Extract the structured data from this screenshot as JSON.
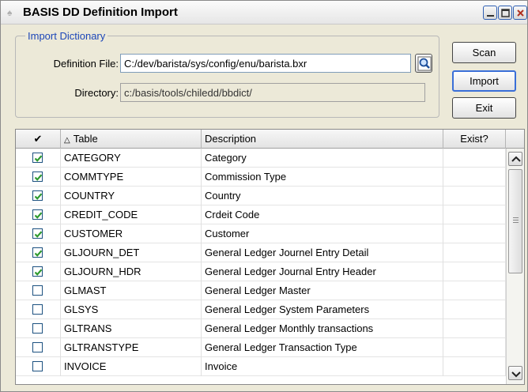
{
  "window": {
    "title": "BASIS DD Definition Import"
  },
  "group": {
    "legend": "Import Dictionary",
    "definition_label": "Definition File:",
    "definition_value": "C:/dev/barista/sys/config/enu/barista.bxr",
    "directory_label": "Directory:",
    "directory_value": "c:/basis/tools/chiledd/bbdict/"
  },
  "actions": {
    "scan": "Scan",
    "import": "Import",
    "exit": "Exit"
  },
  "grid": {
    "headers": {
      "check": "✔",
      "table": "Table",
      "description": "Description",
      "exist": "Exist?"
    },
    "rows": [
      {
        "checked": true,
        "table": "CATEGORY",
        "description": "Category",
        "exist": ""
      },
      {
        "checked": true,
        "table": "COMMTYPE",
        "description": "Commission Type",
        "exist": ""
      },
      {
        "checked": true,
        "table": "COUNTRY",
        "description": "Country",
        "exist": ""
      },
      {
        "checked": true,
        "table": "CREDIT_CODE",
        "description": "Crdeit Code",
        "exist": ""
      },
      {
        "checked": true,
        "table": "CUSTOMER",
        "description": "Customer",
        "exist": ""
      },
      {
        "checked": true,
        "table": "GLJOURN_DET",
        "description": "General Ledger Journel Entry Detail",
        "exist": ""
      },
      {
        "checked": true,
        "table": "GLJOURN_HDR",
        "description": "General Ledger Journal Entry Header",
        "exist": ""
      },
      {
        "checked": false,
        "table": "GLMAST",
        "description": "General Ledger Master",
        "exist": ""
      },
      {
        "checked": false,
        "table": "GLSYS",
        "description": "General Ledger System Parameters",
        "exist": ""
      },
      {
        "checked": false,
        "table": "GLTRANS",
        "description": "General Ledger Monthly transactions",
        "exist": ""
      },
      {
        "checked": false,
        "table": "GLTRANSTYPE",
        "description": "General Ledger Transaction Type",
        "exist": ""
      },
      {
        "checked": false,
        "table": "INVOICE",
        "description": "Invoice",
        "exist": ""
      }
    ]
  },
  "colors": {
    "legend": "#1c46b8",
    "check": "#2e9a2e",
    "focus_border": "#3a6fd8"
  }
}
